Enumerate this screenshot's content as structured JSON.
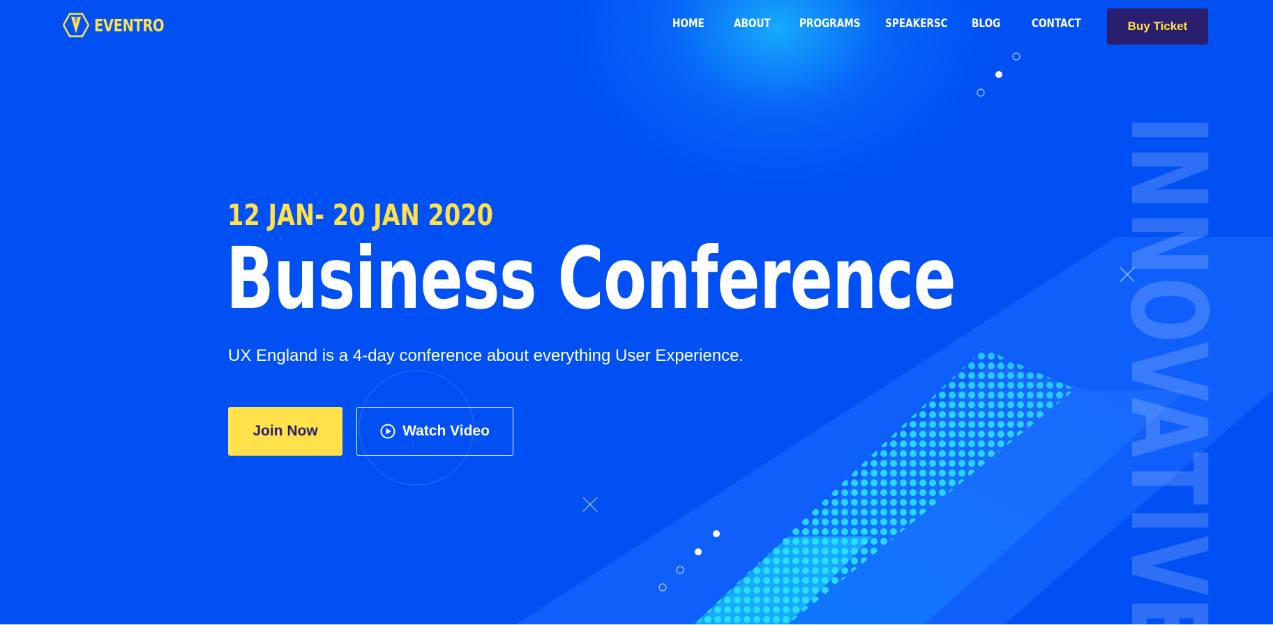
{
  "brand": {
    "name": "EVENTRO",
    "logo_icon": "hexagon-logo-icon",
    "accent_color": "#ffe14c",
    "background_color": "#0050f4",
    "dark_color": "#2a1f6e"
  },
  "nav": {
    "items": [
      {
        "label": "HOME"
      },
      {
        "label": "ABOUT"
      },
      {
        "label": "PROGRAMS"
      },
      {
        "label": "SPEAKERSC"
      },
      {
        "label": "BLOG"
      },
      {
        "label": "CONTACT"
      }
    ],
    "cta_label": "Buy Ticket"
  },
  "hero": {
    "date": "12 JAN- 20 JAN 2020",
    "title": "Business Conference",
    "subtitle": "UX England is a 4-day conference about everything User Experience.",
    "join_label": "Join Now",
    "watch_label": "Watch Video",
    "watch_icon": "play-circle-icon",
    "vertical_word": "INNOVATIVE"
  }
}
